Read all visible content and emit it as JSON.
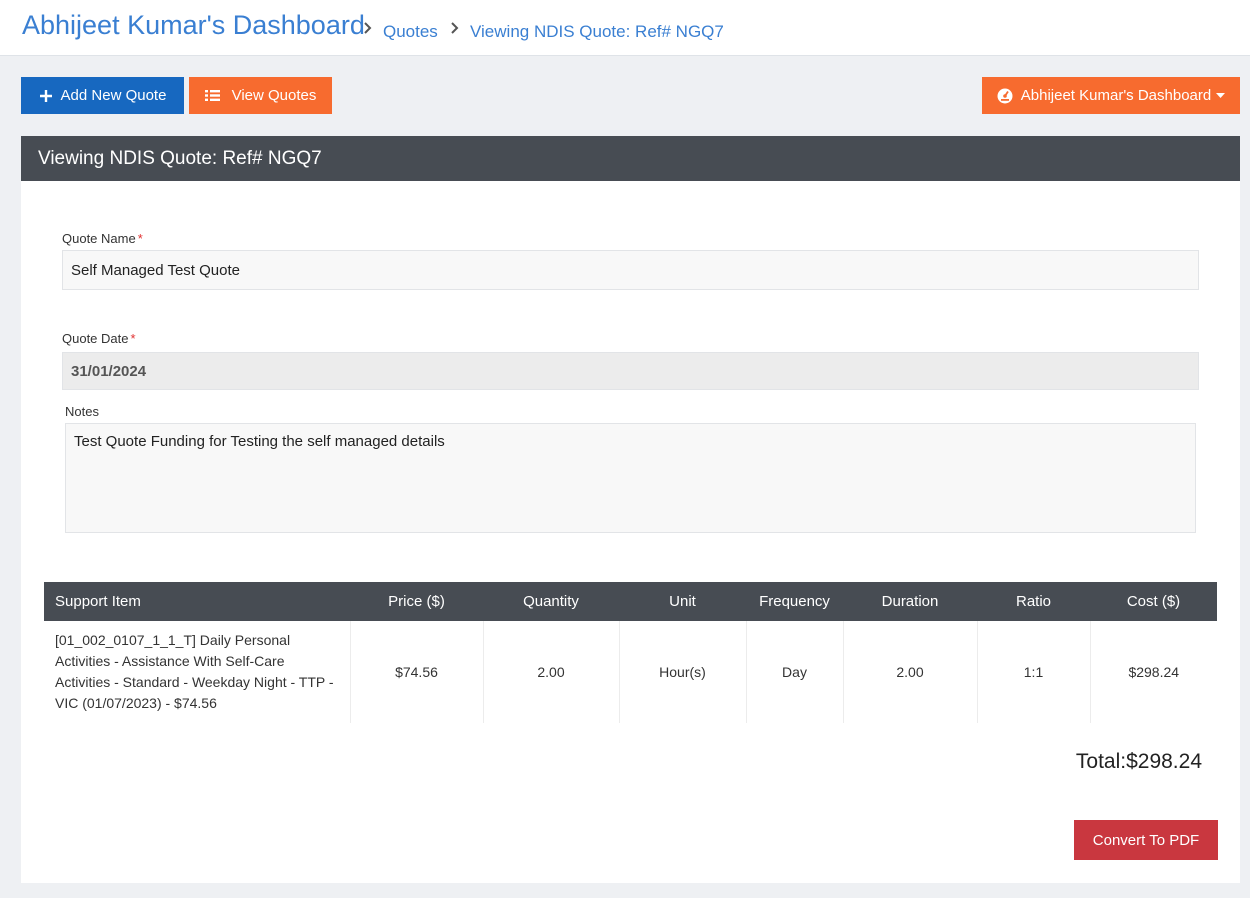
{
  "header": {
    "title": "Abhijeet Kumar's Dashboard",
    "breadcrumbs": [
      "Quotes",
      "Viewing NDIS Quote: Ref# NGQ7"
    ]
  },
  "toolbar": {
    "add_label": "Add New Quote",
    "view_label": "View Quotes",
    "dashboard_label": "Abhijeet Kumar's Dashboard"
  },
  "card": {
    "title": "Viewing NDIS Quote: Ref# NGQ7",
    "quote_name_label": "Quote Name",
    "quote_name_value": "Self Managed Test Quote",
    "quote_date_label": "Quote Date",
    "quote_date_value": "31/01/2024",
    "notes_label": "Notes",
    "notes_value": "Test Quote Funding for Testing the self managed details",
    "required_mark": "*"
  },
  "table": {
    "headers": [
      "Support Item",
      "Price ($)",
      "Quantity",
      "Unit",
      "Frequency",
      "Duration",
      "Ratio",
      "Cost ($)"
    ],
    "rows": [
      [
        "[01_002_0107_1_1_T] Daily Personal Activities - Assistance With Self-Care Activities - Standard - Weekday Night - TTP - VIC (01/07/2023) - $74.56",
        "$74.56",
        "2.00",
        "Hour(s)",
        "Day",
        "2.00",
        "1:1",
        "$298.24"
      ]
    ]
  },
  "total": "Total:$298.24",
  "convert_label": "Convert To PDF",
  "colors": {
    "accent_blue": "#1768c0",
    "orange": "#f76b2f",
    "red": "#c9373f",
    "header_dark": "#474c53",
    "link_blue": "#3a7fd2"
  },
  "icons": [
    "chevron-right-icon",
    "plus-icon",
    "list-icon",
    "dashboard-gauge-icon",
    "caret-down-icon"
  ]
}
